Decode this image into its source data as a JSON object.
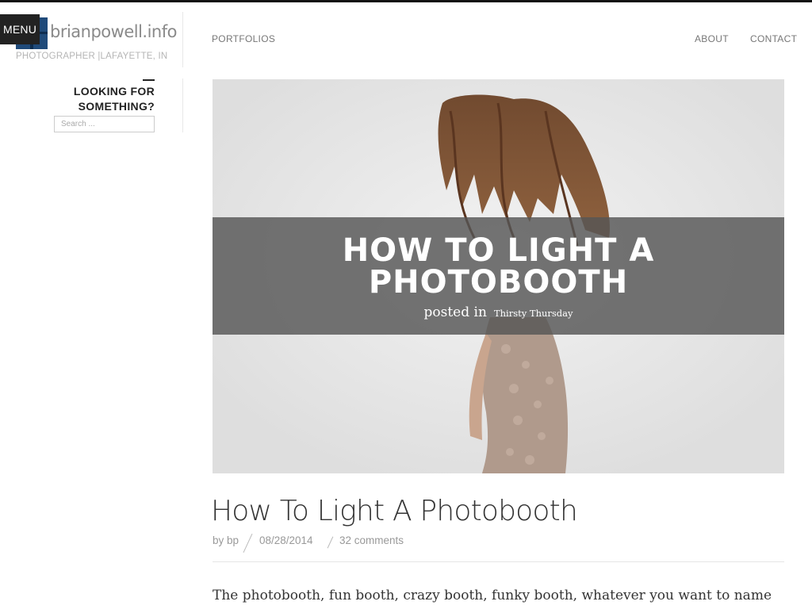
{
  "header": {
    "menu_label": "MENU",
    "site_title": "brianpowell.info",
    "tagline": "PHOTOGRAPHER |LAFAYETTE, IN"
  },
  "nav": {
    "portfolios": "PORTFOLIOS",
    "about": "ABOUT",
    "contact": "CONTACT"
  },
  "sidebar": {
    "widget_title_line1": "LOOKING FOR",
    "widget_title_line2": "SOMETHING?",
    "search_placeholder": "Search ..."
  },
  "hero": {
    "title_line1": "HOW TO LIGHT A",
    "title_line2": "PHOTOBOOTH",
    "posted_in": "posted in",
    "category": "Thirsty Thursday"
  },
  "post": {
    "title": "How To Light A Photobooth",
    "author": "by bp",
    "date": "08/28/2014",
    "comments": "32 comments",
    "excerpt": "The photobooth, fun booth, crazy booth, funky booth, whatever you want to name"
  },
  "colors": {
    "menu_bg": "#222222",
    "logo_blue": "#1f4a7a",
    "overlay": "#555555"
  }
}
